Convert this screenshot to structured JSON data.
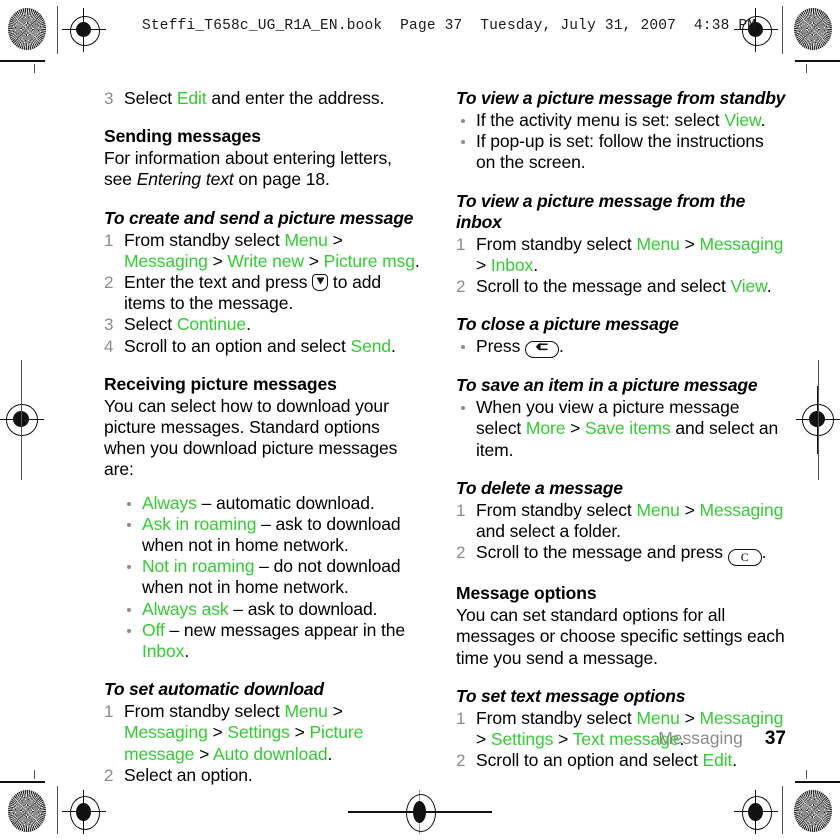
{
  "header": {
    "text": "Steffi_T658c_UG_R1A_EN.book  Page 37  Tuesday, July 31, 2007  4:38 PM"
  },
  "colors": {
    "ui_green": "#33cc33",
    "step_number_gray": "#8c8c8c",
    "bullet_gray": "#8c8c8c",
    "footer_gray": "#8c8c8c",
    "text_black": "#000000"
  },
  "left_column": {
    "step_3_select_edit": {
      "num": "3",
      "pre": "Select ",
      "ui": "Edit",
      "post": " and enter the address."
    },
    "sending_messages": {
      "heading": "Sending messages",
      "body_pre": "For information about entering letters, see ",
      "body_italic": "Entering text",
      "body_post": " on page 18."
    },
    "create_send_picture": {
      "heading": "To create and send a picture message",
      "steps": [
        {
          "num": "1",
          "parts": "From standby select Menu > Messaging > Write new > Picture msg.",
          "pre": "From standby select ",
          "ui1": "Menu",
          "mid1": " > ",
          "ui2": "Messaging",
          "mid2": " > ",
          "ui3": "Write new",
          "mid3": " > ",
          "ui4": "Picture msg",
          "post": "."
        },
        {
          "num": "2",
          "pre": "Enter the text and press ",
          "icon": "navigation-down-key-icon",
          "post": " to add items to the message."
        },
        {
          "num": "3",
          "pre": "Select ",
          "ui1": "Continue",
          "post": "."
        },
        {
          "num": "4",
          "pre": "Scroll to an option and select ",
          "ui1": "Send",
          "post": "."
        }
      ]
    },
    "receiving_picture": {
      "heading": "Receiving picture messages",
      "body": "You can select how to download your picture messages. Standard options when you download picture messages are:",
      "options": [
        {
          "ui": "Always",
          "desc": " – automatic download."
        },
        {
          "ui": "Ask in roaming",
          "desc": " – ask to download when not in home network."
        },
        {
          "ui": "Not in roaming",
          "desc": " – do not download when not in home network."
        },
        {
          "ui": "Always ask",
          "desc": " – ask to download."
        },
        {
          "ui": "Off",
          "desc_pre": " – new messages appear in the ",
          "ui2": "Inbox",
          "desc_post": "."
        }
      ]
    },
    "auto_download": {
      "heading": "To set automatic download",
      "steps": [
        {
          "num": "1",
          "pre": "From standby select ",
          "ui1": "Menu",
          "mid1": " > ",
          "ui2": "Messaging",
          "mid2": " > ",
          "ui3": "Settings",
          "mid3": " > ",
          "ui4": "Picture message",
          "mid4": " > ",
          "ui5": "Auto download",
          "post": "."
        },
        {
          "num": "2",
          "pre": "Select an option.",
          "post": ""
        }
      ]
    }
  },
  "right_column": {
    "view_from_standby": {
      "heading": "To view a picture message from standby",
      "bullets": [
        {
          "pre": "If the activity menu is set: select ",
          "ui": "View",
          "post": "."
        },
        {
          "pre": "If pop-up is set: follow the instructions on the screen.",
          "ui": "",
          "post": ""
        }
      ]
    },
    "view_from_inbox": {
      "heading": "To view a picture message from the inbox",
      "steps": [
        {
          "num": "1",
          "pre": "From standby select ",
          "ui1": "Menu",
          "mid1": " > ",
          "ui2": "Messaging",
          "mid2": " > ",
          "ui3": "Inbox",
          "post": "."
        },
        {
          "num": "2",
          "pre": "Scroll to the message and select ",
          "ui1": "View",
          "post": "."
        }
      ]
    },
    "close_picture": {
      "heading": "To close a picture message",
      "bullet_pre": "Press ",
      "bullet_icon": "back-key-icon",
      "bullet_post": "."
    },
    "save_item": {
      "heading": "To save an item in a picture message",
      "bullet_pre": "When you view a picture message select ",
      "ui1": "More",
      "mid1": " > ",
      "ui2": "Save items",
      "post": " and select an item."
    },
    "delete_message": {
      "heading": "To delete a message",
      "steps": [
        {
          "num": "1",
          "pre": "From standby select ",
          "ui1": "Menu",
          "mid1": " > ",
          "ui2": "Messaging",
          "post": " and select a folder."
        },
        {
          "num": "2",
          "pre": "Scroll to the message and press ",
          "icon": "clear-key-icon",
          "icon_label": "C",
          "post": "."
        }
      ]
    },
    "message_options": {
      "heading": "Message options",
      "body": "You can set standard options for all messages or choose specific settings each time you send a message."
    },
    "text_message_options": {
      "heading": "To set text message options",
      "steps": [
        {
          "num": "1",
          "pre": "From standby select ",
          "ui1": "Menu",
          "mid1": " > ",
          "ui2": "Messaging",
          "mid2": " > ",
          "ui3": "Settings",
          "mid3": " > ",
          "ui4": "Text message",
          "post": "."
        },
        {
          "num": "2",
          "pre": "Scroll to an option and select ",
          "ui1": "Edit",
          "post": "."
        }
      ]
    }
  },
  "footer": {
    "chapter": "Messaging",
    "page_number": "37"
  }
}
